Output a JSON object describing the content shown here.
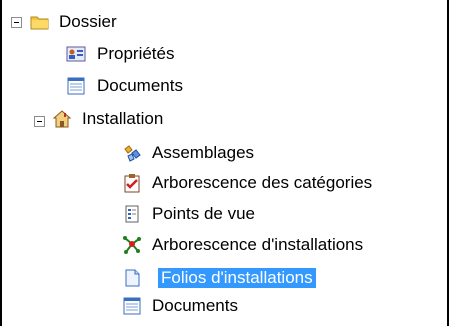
{
  "tree": {
    "root": {
      "label": "Dossier",
      "expanded": true,
      "icon": "folder-icon"
    },
    "root_children": [
      {
        "label": "Propriétés",
        "icon": "properties-icon"
      },
      {
        "label": "Documents",
        "icon": "document-list-icon"
      },
      {
        "label": "Installation",
        "icon": "house-icon",
        "expanded": true
      }
    ],
    "installation_children": [
      {
        "label": "Assemblages",
        "icon": "assembly-icon"
      },
      {
        "label": "Arborescence des catégories",
        "icon": "clipboard-check-icon"
      },
      {
        "label": "Points de vue",
        "icon": "viewpoints-icon"
      },
      {
        "label": "Arborescence d'installations",
        "icon": "network-tree-icon"
      },
      {
        "label": "Folios d'installations",
        "icon": "page-icon",
        "selected": true
      },
      {
        "label": "Documents",
        "icon": "document-list-icon"
      }
    ]
  },
  "colors": {
    "selection": "#3399ff",
    "folder": "#f5c542",
    "border": "#000000"
  }
}
